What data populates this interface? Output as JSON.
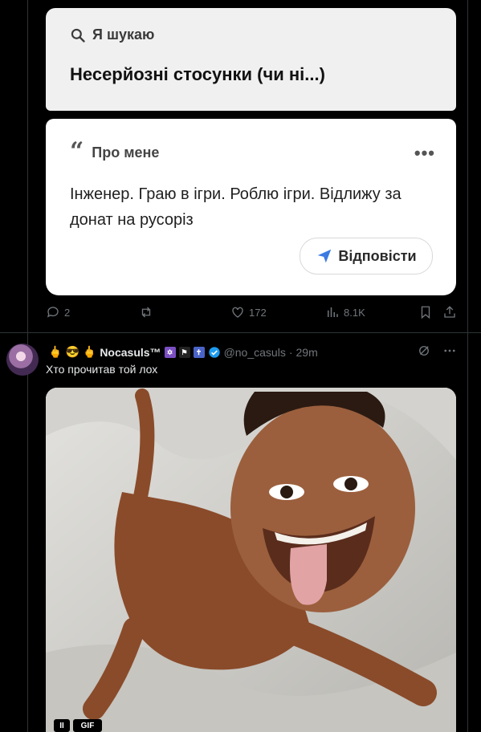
{
  "card": {
    "search_label": "Я шукаю",
    "looking_for": "Несерйозні стосунки (чи ні...)",
    "about_label": "Про мене",
    "more_dots": "•••",
    "bio": "Інженер. Граю в ігри. Роблю ігри. Відлижу за донат на русоріз",
    "reply_label": "Відповісти"
  },
  "post1_actions": {
    "replies": "2",
    "likes": "172",
    "views": "8.1K"
  },
  "post2": {
    "name": "Nocasuls™",
    "flag_text": "⚑",
    "handle": "@no_casuls",
    "separator": "·",
    "time": "29m",
    "text": "Хто прочитав той лох",
    "media_badges": {
      "alt": "II",
      "gif": "GIF"
    }
  },
  "colors": {
    "background": "#000000",
    "muted": "#71767b",
    "verified": "#1d9bf0",
    "reply_arrow": "#3b7ae0"
  }
}
